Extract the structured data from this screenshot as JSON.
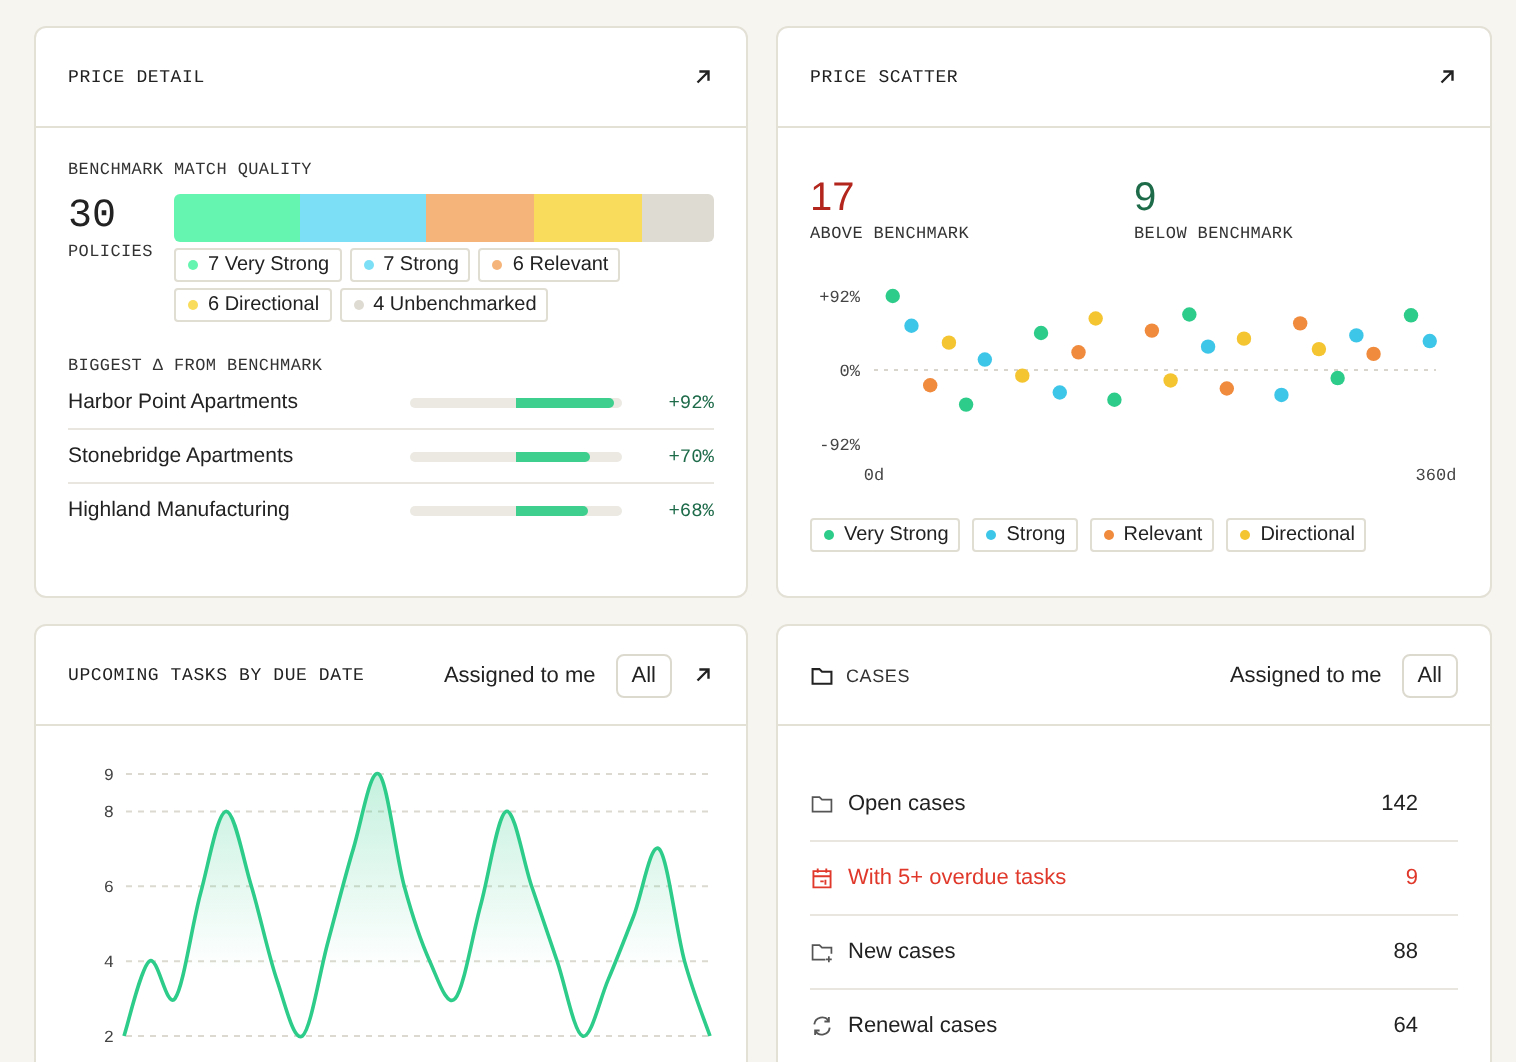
{
  "price_detail": {
    "title": "PRICE DETAIL",
    "quality_label": "BENCHMARK MATCH QUALITY",
    "count": "30",
    "count_label": "POLICIES",
    "segments": [
      {
        "count": "7",
        "label": "Very Strong",
        "color": "#66f5b0"
      },
      {
        "count": "7",
        "label": "Strong",
        "color": "#7ddff5"
      },
      {
        "count": "6",
        "label": "Relevant",
        "color": "#f5b57a"
      },
      {
        "count": "6",
        "label": "Directional",
        "color": "#f9dc5c"
      },
      {
        "count": "4",
        "label": "Unbenchmarked",
        "color": "#dedbd2"
      }
    ],
    "delta_label": "BIGGEST Δ FROM BENCHMARK",
    "deltas": [
      {
        "name": "Harbor Point Apartments",
        "value": "+92%"
      },
      {
        "name": "Stonebridge Apartments",
        "value": "+70%"
      },
      {
        "name": "Highland Manufacturing",
        "value": "+68%"
      }
    ]
  },
  "price_scatter": {
    "title": "PRICE SCATTER",
    "above": {
      "value": "17",
      "label": "ABOVE BENCHMARK"
    },
    "below": {
      "value": "9",
      "label": "BELOW BENCHMARK"
    },
    "chart_data": {
      "type": "scatter",
      "xlim": [
        0,
        360
      ],
      "ylim": [
        -92,
        92
      ],
      "xticks": [
        {
          "value": 0,
          "label": "0d"
        },
        {
          "value": 360,
          "label": "360d"
        }
      ],
      "yticks": [
        {
          "value": 92,
          "label": "+92%"
        },
        {
          "value": 0,
          "label": "0%"
        },
        {
          "value": -92,
          "label": "-92%"
        }
      ],
      "series": [
        {
          "name": "Very Strong",
          "color": "#2ecc8a",
          "x": [
            12,
            59,
            107,
            154,
            202,
            297,
            344
          ],
          "values": [
            92,
            -43,
            46,
            -37,
            69,
            -10,
            68
          ]
        },
        {
          "name": "Strong",
          "color": "#3ec6e8",
          "x": [
            24,
            71,
            119,
            214,
            261,
            309,
            356
          ],
          "values": [
            55,
            13,
            -28,
            29,
            -31,
            43,
            36
          ]
        },
        {
          "name": "Relevant",
          "color": "#f08a3c",
          "x": [
            36,
            131,
            178,
            226,
            273,
            320
          ],
          "values": [
            -19,
            22,
            49,
            -23,
            58,
            20
          ]
        },
        {
          "name": "Directional",
          "color": "#f5c431",
          "x": [
            48,
            95,
            142,
            190,
            237,
            285
          ],
          "values": [
            34,
            -7,
            64,
            -13,
            39,
            26
          ]
        }
      ]
    }
  },
  "tasks": {
    "title": "UPCOMING TASKS BY DUE DATE",
    "filter_label": "Assigned to me",
    "filter_button": "All",
    "chart_data": {
      "type": "area",
      "grid": true,
      "ylim": [
        2,
        9
      ],
      "yticks": [
        2,
        4,
        6,
        8,
        9
      ],
      "values": [
        2,
        4,
        3,
        5.8,
        8,
        6,
        3.5,
        2,
        4.5,
        7,
        9,
        6,
        4,
        3,
        5.5,
        8,
        6,
        4,
        2,
        3.5,
        5.2,
        7,
        4,
        2
      ]
    }
  },
  "cases": {
    "title": "CASES",
    "filter_label": "Assigned to me",
    "filter_button": "All",
    "rows": [
      {
        "kind": "folder",
        "label": "Open cases",
        "count": "142",
        "warning": false
      },
      {
        "kind": "calendar",
        "label": "With 5+ overdue tasks",
        "count": "9",
        "warning": true
      },
      {
        "kind": "new-folder",
        "label": "New cases",
        "count": "88",
        "warning": false
      },
      {
        "kind": "renewal",
        "label": "Renewal cases",
        "count": "64",
        "warning": false
      }
    ]
  }
}
